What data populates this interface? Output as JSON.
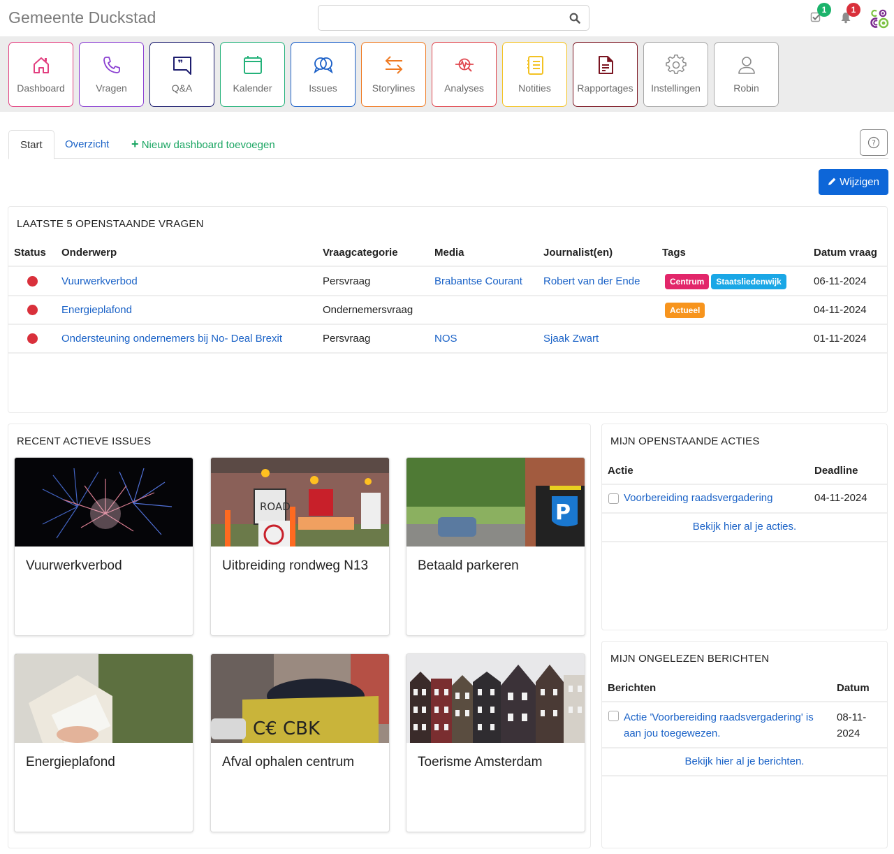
{
  "header": {
    "title": "Gemeente Duckstad",
    "search": {
      "value": "",
      "placeholder": ""
    },
    "tasks_badge": "1",
    "notifications_badge": "1",
    "colors": {
      "tasks_badge": "#1bb36b",
      "notifications_badge": "#d9303b"
    }
  },
  "nav": {
    "items": [
      {
        "label": "Dashboard",
        "icon": "home-icon",
        "color": "#e23f7f"
      },
      {
        "label": "Vragen",
        "icon": "phone-icon",
        "color": "#8a3fd1"
      },
      {
        "label": "Q&A",
        "icon": "quote-bubble-icon",
        "color": "#1d1d6e"
      },
      {
        "label": "Kalender",
        "icon": "calendar-icon",
        "color": "#24b27a"
      },
      {
        "label": "Issues",
        "icon": "chat-bubbles-icon",
        "color": "#1a5fc7"
      },
      {
        "label": "Storylines",
        "icon": "swap-arrows-icon",
        "color": "#ef7a22"
      },
      {
        "label": "Analyses",
        "icon": "analysis-icon",
        "color": "#e0474f"
      },
      {
        "label": "Notities",
        "icon": "notebook-icon",
        "color": "#f3c223"
      },
      {
        "label": "Rapportages",
        "icon": "document-icon",
        "color": "#7a1420"
      },
      {
        "label": "Instellingen",
        "icon": "gear-icon",
        "color": "#8a8a8a"
      },
      {
        "label": "Robin",
        "icon": "user-icon",
        "color": "#8a8a8a"
      }
    ]
  },
  "tabs": {
    "start": "Start",
    "overview": "Overzicht",
    "add": "Nieuw dashboard toevoegen"
  },
  "toolbar": {
    "edit_label": "Wijzigen"
  },
  "questions": {
    "title": "LAATSTE 5 OPENSTAANDE VRAGEN",
    "columns": [
      "Status",
      "Onderwerp",
      "Vraagcategorie",
      "Media",
      "Journalist(en)",
      "Tags",
      "Datum vraag"
    ],
    "rows": [
      {
        "status": "open",
        "subject": "Vuurwerkverbod",
        "category": "Persvraag",
        "media": "Brabantse Courant",
        "journalist": "Robert van der Ende",
        "tags": [
          {
            "label": "Centrum",
            "color": "#e2266a"
          },
          {
            "label": "Staatsliedenwijk",
            "color": "#1aa7e6"
          }
        ],
        "date": "06-11-2024"
      },
      {
        "status": "open",
        "subject": "Energieplafond",
        "category": "Ondernemersvraag",
        "media": "",
        "journalist": "",
        "tags": [
          {
            "label": "Actueel",
            "color": "#f7941d"
          }
        ],
        "date": "04-11-2024"
      },
      {
        "status": "open",
        "subject": "Ondersteuning ondernemers bij No- Deal Brexit",
        "category": "Persvraag",
        "media": "NOS",
        "journalist": "Sjaak Zwart",
        "tags": [],
        "date": "01-11-2024"
      }
    ]
  },
  "issues": {
    "title": "RECENT ACTIEVE ISSUES",
    "cards": [
      {
        "title": "Vuurwerkverbod",
        "image": "fireworks"
      },
      {
        "title": "Uitbreiding rondweg N13",
        "image": "road-signs"
      },
      {
        "title": "Betaald parkeren",
        "image": "parking-meter"
      },
      {
        "title": "Energieplafond",
        "image": "energy-meter"
      },
      {
        "title": "Afval ophalen centrum",
        "image": "garbage-container"
      },
      {
        "title": "Toerisme Amsterdam",
        "image": "canal-houses"
      }
    ]
  },
  "actions": {
    "title": "MIJN OPENSTAANDE ACTIES",
    "columns": [
      "Actie",
      "Deadline"
    ],
    "rows": [
      {
        "label": "Voorbereiding raadsvergadering",
        "deadline": "04-11-2024",
        "checked": false
      }
    ],
    "more_link": "Bekijk hier al je acties."
  },
  "messages": {
    "title": "MIJN ONGELEZEN BERICHTEN",
    "columns": [
      "Berichten",
      "Datum"
    ],
    "rows": [
      {
        "label_line1": "Actie 'Voorbereiding raadsvergadering' is",
        "label_line2": "aan jou toegewezen.",
        "date_line1": "08-11-",
        "date_line2": "2024",
        "checked": false
      }
    ],
    "more_link": "Bekijk hier al je berichten."
  }
}
